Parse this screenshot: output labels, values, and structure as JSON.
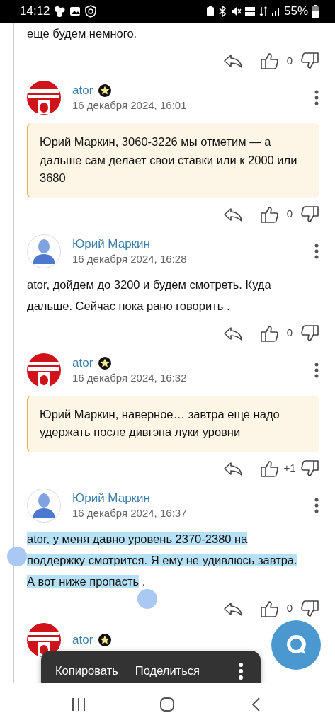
{
  "status_bar": {
    "time": "14:12",
    "battery": "55%"
  },
  "comments": [
    {
      "kind": "tail",
      "body": [
        {
          "text": "еще будем немного.",
          "selected": false
        }
      ],
      "score": "0"
    },
    {
      "kind": "full",
      "author": "ator",
      "avatar": {
        "kind": "logo"
      },
      "badge": true,
      "date": "16 декабря 2024, 16:01",
      "quote": true,
      "body": [
        {
          "text": "Юрий Маркин, 3060-3226 мы отметим — а дальше сам делает свои ставки или к 2000 или 3680",
          "selected": false
        }
      ],
      "score": "0"
    },
    {
      "kind": "full",
      "author": "Юрий Маркин",
      "avatar": {
        "kind": "person"
      },
      "badge": false,
      "date": "16 декабря 2024, 16:28",
      "quote": false,
      "body": [
        {
          "text": "ator, дойдем до 3200 и будем смотреть. Куда дальше. Сейчас пока рано говорить .",
          "selected": false
        }
      ],
      "score": "0"
    },
    {
      "kind": "full",
      "author": "ator",
      "avatar": {
        "kind": "logo"
      },
      "badge": true,
      "date": "16 декабря 2024, 16:32",
      "quote": true,
      "body": [
        {
          "text": "Юрий Маркин, наверное… завтра еще надо удержать после дивгэпа луки уровни",
          "selected": false
        }
      ],
      "score": "+1"
    },
    {
      "kind": "full",
      "author": "Юрий Маркин",
      "avatar": {
        "kind": "person"
      },
      "badge": false,
      "date": "16 декабря 2024, 16:37",
      "quote": false,
      "body": [
        {
          "text": "ator, у меня давно уровень 2370-2380 на поддержку смотрится. Я ему не удивлюсь завтра. А вот ниже пропасть",
          "selected": true
        },
        {
          "text": " .",
          "selected": false
        }
      ],
      "score": "0"
    },
    {
      "kind": "head",
      "author": "ator",
      "avatar": {
        "kind": "logo"
      },
      "badge": true
    }
  ],
  "selection_toolbar": {
    "actions": [
      "Копировать",
      "Поделиться"
    ]
  }
}
